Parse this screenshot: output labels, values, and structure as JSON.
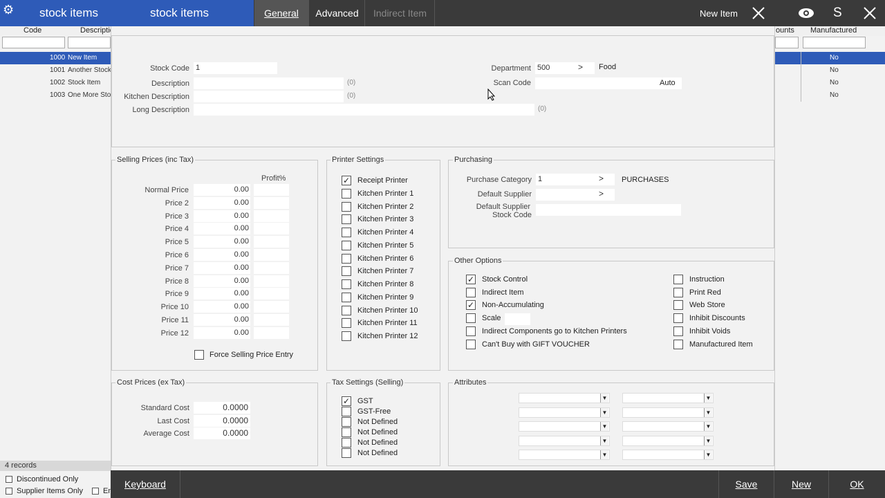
{
  "header": {
    "title_left": "stock items",
    "title_right": "stock items",
    "tabs": [
      {
        "label": "General",
        "state": "active"
      },
      {
        "label": "Advanced",
        "state": "normal"
      },
      {
        "label": "Indirect Item",
        "state": "disabled"
      }
    ],
    "new_item_label": "New Item",
    "user_initial": "S"
  },
  "grid": {
    "columns": {
      "code": "Code",
      "description": "Descriptio",
      "discounts": "ounts",
      "manufactured": "Manufactured"
    },
    "rows": [
      {
        "code": "1000",
        "description": "New Item",
        "manufactured": "No"
      },
      {
        "code": "1001",
        "description": "Another Stock",
        "manufactured": "No"
      },
      {
        "code": "1002",
        "description": "Stock Item",
        "manufactured": "No"
      },
      {
        "code": "1003",
        "description": "One More Sto",
        "manufactured": "No"
      }
    ],
    "record_count": "4 records",
    "discontinued_only": "Discontinued Only",
    "supplier_items_only": "Supplier Items Only",
    "en_label": "En"
  },
  "general": {
    "stock_code_label": "Stock Code",
    "stock_code_value": "1",
    "description_label": "Description",
    "description_count": "(0)",
    "kitchen_description_label": "Kitchen Description",
    "kitchen_description_count": "(0)",
    "long_description_label": "Long Description",
    "long_description_count": "(0)",
    "department_label": "Department",
    "department_value": "500",
    "department_arrow": ">",
    "department_name": "Food",
    "scan_code_label": "Scan Code",
    "scan_code_value": "Auto"
  },
  "selling_prices": {
    "title": "Selling Prices (inc Tax)",
    "profit_header": "Profit%",
    "rows": [
      {
        "label": "Normal Price",
        "value": "0.00"
      },
      {
        "label": "Price 2",
        "value": "0.00"
      },
      {
        "label": "Price 3",
        "value": "0.00"
      },
      {
        "label": "Price 4",
        "value": "0.00"
      },
      {
        "label": "Price 5",
        "value": "0.00"
      },
      {
        "label": "Price 6",
        "value": "0.00"
      },
      {
        "label": "Price 7",
        "value": "0.00"
      },
      {
        "label": "Price 8",
        "value": "0.00"
      },
      {
        "label": "Price 9",
        "value": "0.00"
      },
      {
        "label": "Price 10",
        "value": "0.00"
      },
      {
        "label": "Price 11",
        "value": "0.00"
      },
      {
        "label": "Price 12",
        "value": "0.00"
      }
    ],
    "force_label": "Force Selling Price Entry"
  },
  "printer_settings": {
    "title": "Printer Settings",
    "items": [
      {
        "label": "Receipt Printer",
        "checked": true
      },
      {
        "label": "Kitchen Printer 1",
        "checked": false
      },
      {
        "label": "Kitchen Printer 2",
        "checked": false
      },
      {
        "label": "Kitchen Printer 3",
        "checked": false
      },
      {
        "label": "Kitchen Printer 4",
        "checked": false
      },
      {
        "label": "Kitchen Printer 5",
        "checked": false
      },
      {
        "label": "Kitchen Printer 6",
        "checked": false
      },
      {
        "label": "Kitchen Printer 7",
        "checked": false
      },
      {
        "label": "Kitchen Printer 8",
        "checked": false
      },
      {
        "label": "Kitchen Printer 9",
        "checked": false
      },
      {
        "label": "Kitchen Printer 10",
        "checked": false
      },
      {
        "label": "Kitchen Printer 11",
        "checked": false
      },
      {
        "label": "Kitchen Printer 12",
        "checked": false
      }
    ]
  },
  "purchasing": {
    "title": "Purchasing",
    "category_label": "Purchase Category",
    "category_value": "1",
    "category_arrow": ">",
    "category_name": "PURCHASES",
    "supplier_label": "Default Supplier",
    "supplier_arrow": ">",
    "supplier_code_label_1": "Default Supplier",
    "supplier_code_label_2": "Stock Code"
  },
  "other_options": {
    "title": "Other Options",
    "left": [
      {
        "label": "Stock Control",
        "checked": true
      },
      {
        "label": "Indirect Item",
        "checked": false
      },
      {
        "label": "Non-Accumulating",
        "checked": true
      },
      {
        "label": "Scale",
        "checked": false
      },
      {
        "label": "Indirect Components go to Kitchen Printers",
        "checked": false
      },
      {
        "label": "Can't Buy with GIFT VOUCHER",
        "checked": false
      }
    ],
    "right": [
      {
        "label": "Instruction",
        "checked": false
      },
      {
        "label": "Print Red",
        "checked": false
      },
      {
        "label": "Web Store",
        "checked": false
      },
      {
        "label": "Inhibit Discounts",
        "checked": false
      },
      {
        "label": "Inhibit Voids",
        "checked": false
      },
      {
        "label": "Manufactured Item",
        "checked": false
      }
    ]
  },
  "cost_prices": {
    "title": "Cost Prices (ex Tax)",
    "rows": [
      {
        "label": "Standard Cost",
        "value": "0.0000"
      },
      {
        "label": "Last Cost",
        "value": "0.0000"
      },
      {
        "label": "Average Cost",
        "value": "0.0000"
      }
    ]
  },
  "tax_settings": {
    "title": "Tax Settings (Selling)",
    "items": [
      {
        "label": "GST",
        "checked": true
      },
      {
        "label": "GST-Free",
        "checked": false
      },
      {
        "label": "Not Defined",
        "checked": false
      },
      {
        "label": "Not Defined",
        "checked": false
      },
      {
        "label": "Not Defined",
        "checked": false
      },
      {
        "label": "Not Defined",
        "checked": false
      }
    ]
  },
  "attributes": {
    "title": "Attributes"
  },
  "footer": {
    "keyboard": "Keyboard",
    "save": "Save",
    "new": "New",
    "ok": "OK"
  },
  "colors": {
    "accent": "#2e5bb8",
    "bar": "#3a3a3a"
  }
}
